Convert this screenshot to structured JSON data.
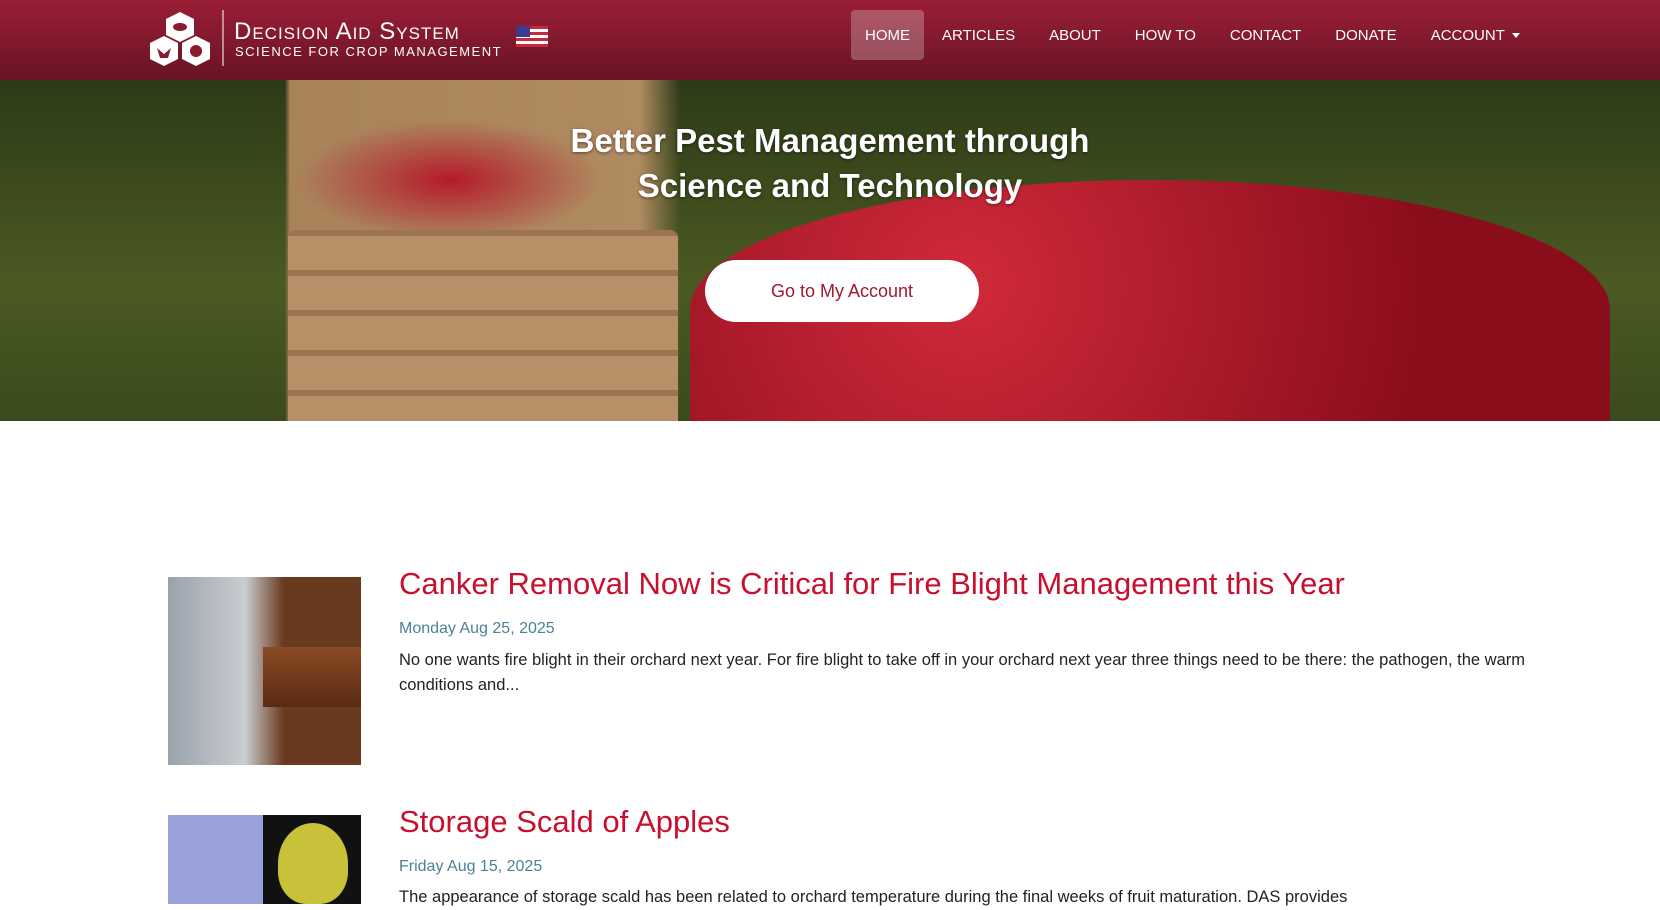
{
  "header": {
    "brand_title": "Decision Aid System",
    "brand_subtitle": "SCIENCE FOR CROP MANAGEMENT",
    "flag_icon": "us-flag-icon",
    "menu": [
      {
        "label": "HOME",
        "active": true
      },
      {
        "label": "ARTICLES"
      },
      {
        "label": "ABOUT"
      },
      {
        "label": "HOW TO"
      },
      {
        "label": "CONTACT"
      },
      {
        "label": "DONATE"
      },
      {
        "label": "ACCOUNT"
      }
    ],
    "colors": {
      "nav_top": "#9a1e36",
      "nav_bottom": "#681424"
    }
  },
  "hero": {
    "title_line1": "Better Pest Management through",
    "title_line2": "Science and Technology",
    "button": "Go to My Account"
  },
  "articles": [
    {
      "title": "Canker Removal Now is Critical for Fire Blight Management this Year",
      "date": "Monday Aug 25, 2025",
      "excerpt": "No one wants fire blight in their orchard next year. For fire blight to take off in your orchard next year three things need to be there: the pathogen, the warm conditions and..."
    },
    {
      "title": "Storage Scald of Apples",
      "date": "Friday Aug 15, 2025",
      "excerpt": "The appearance of storage scald has been related to orchard temperature during the final weeks of fruit maturation. DAS provides"
    }
  ],
  "colors": {
    "title": "#c8102e",
    "date": "#4a8296"
  }
}
